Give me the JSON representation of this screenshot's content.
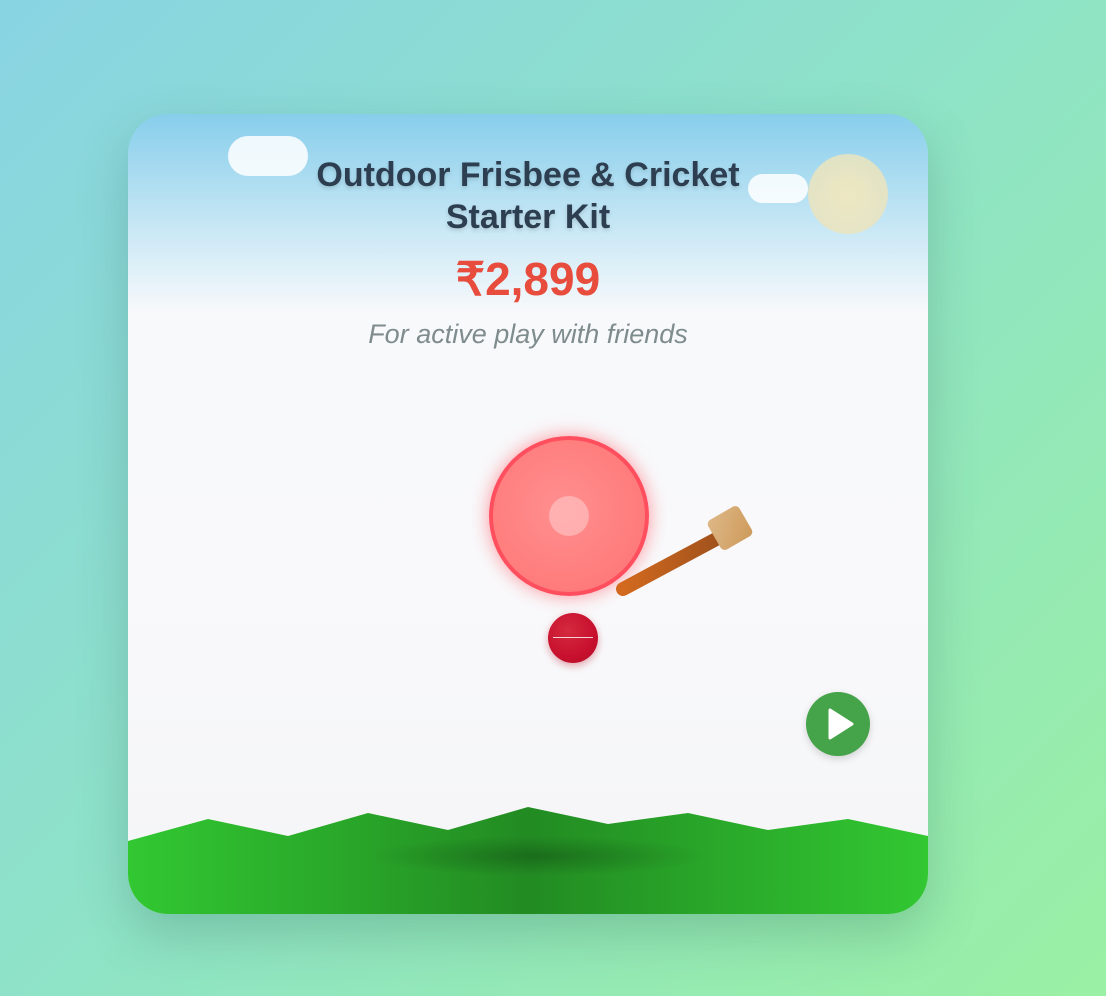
{
  "product": {
    "title_line1": "Outdoor Frisbee & Cricket",
    "title_line2": "Starter Kit",
    "price": "₹2,899",
    "tagline": "For active play with friends"
  },
  "icons": {
    "play": "play-icon",
    "frisbee": "frisbee-icon",
    "bat": "cricket-bat-icon",
    "ball": "cricket-ball-icon"
  },
  "colors": {
    "title": "#2c3e50",
    "price": "#e74c3c",
    "tagline": "#7f8c8d",
    "frisbee": "#ff7b7b",
    "ball": "#c8102e",
    "play_button": "#45a349",
    "grass": "#32c832"
  }
}
